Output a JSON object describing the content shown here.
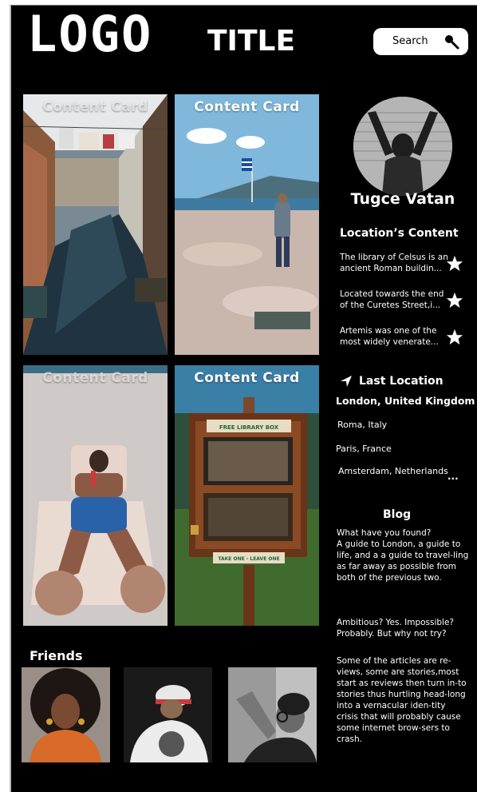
{
  "header": {
    "logo": "LOGO",
    "title": "TITLE",
    "search_label": "Search"
  },
  "cards": [
    {
      "title": "Content Card"
    },
    {
      "title": "Content Card"
    },
    {
      "title": "Content Card"
    },
    {
      "title": "Content Card"
    }
  ],
  "card_signage": {
    "library_box_top": "FREE LIBRARY BOX",
    "library_box_bottom": "TAKE ONE - LEAVE ONE"
  },
  "profile": {
    "name": "Tugce Vatan"
  },
  "locations_content": {
    "title": "Location’s Content",
    "items": [
      {
        "text": "The library of Celsus is an ancient Roman buildin..."
      },
      {
        "text": "Located towards the end of the Curetes Street,i..."
      },
      {
        "text": "Artemis was one of the most widely venerate..."
      }
    ]
  },
  "last_location": {
    "title": "Last Location",
    "current": "London, United Kingdom",
    "history": [
      "Roma, Italy",
      "Paris, France",
      "Amsterdam, Netherlands"
    ],
    "more": "..."
  },
  "blog": {
    "title": "Blog",
    "paragraphs": [
      "What have you found?\nA guide to London, a guide to life, and a a guide to travel-ling as far away as possible from both of the previous two.",
      "Ambitious? Yes. Impossible? Probably. But why not try?",
      "Some of the articles are re-views, some are stories,most start as reviews then turn in-to stories thus hurtling head-long into a vernacular iden-tity crisis that will probably cause some internet brow-sers to crash."
    ]
  },
  "friends": {
    "title": "Friends"
  },
  "colors": {
    "background": "#000000",
    "text": "#ffffff",
    "search_bg": "#ffffff"
  }
}
